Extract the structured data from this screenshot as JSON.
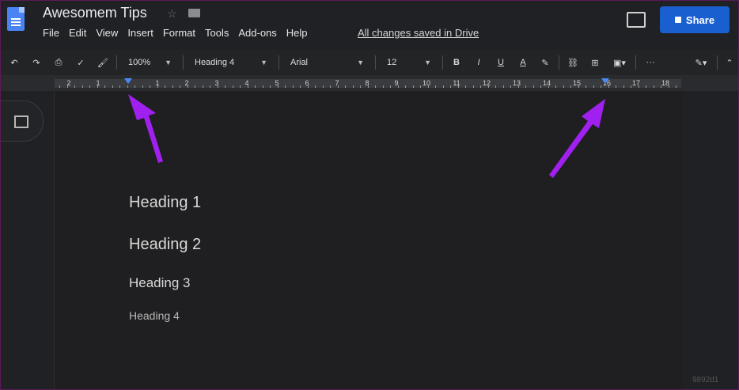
{
  "header": {
    "title": "Awesomem Tips",
    "menu": [
      "File",
      "Edit",
      "View",
      "Insert",
      "Format",
      "Tools",
      "Add-ons",
      "Help"
    ],
    "saved_status": "All changes saved in Drive",
    "share_label": "Share"
  },
  "toolbar": {
    "zoom": "100%",
    "style": "Heading 4",
    "font": "Arial",
    "font_size": "12",
    "bold_label": "B",
    "italic_label": "I",
    "underline_label": "U",
    "text_color_label": "A",
    "more_label": "···"
  },
  "ruler": {
    "numbers": [
      "2",
      "1",
      "1",
      "2",
      "3",
      "4",
      "5",
      "6",
      "7",
      "8",
      "9",
      "10",
      "11",
      "12",
      "13",
      "14",
      "15",
      "16",
      "17",
      "18"
    ]
  },
  "document": {
    "headings": [
      "Heading 1",
      "Heading 2",
      "Heading 3",
      "Heading 4"
    ]
  },
  "watermark": "9892d1"
}
